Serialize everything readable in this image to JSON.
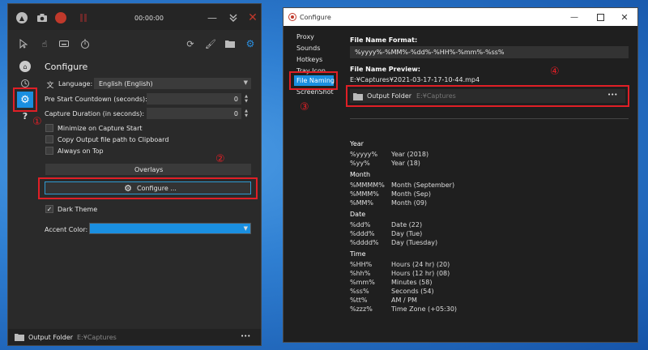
{
  "main": {
    "timer": "00:00:00",
    "title": "Configure",
    "language_label": "Language:",
    "language_value": "English (English)",
    "pre_start_label": "Pre Start Countdown (seconds):",
    "pre_start_value": "0",
    "duration_label": "Capture Duration (in seconds):",
    "duration_value": "0",
    "minimize_label": "Minimize on Capture Start",
    "copy_label": "Copy Output file path to Clipboard",
    "ontop_label": "Always on Top",
    "overlays_label": "Overlays",
    "configure_button": "Configure ...",
    "dark_theme_label": "Dark Theme",
    "dark_theme_checked": true,
    "accent_label": "Accent Color:",
    "accent_color": "#1a8fe0",
    "output_label": "Output Folder",
    "output_path": "E:¥Captures",
    "more": "•••",
    "markers": {
      "one": "①",
      "two": "②"
    }
  },
  "config": {
    "title": "Configure",
    "nav": [
      "Proxy",
      "Sounds",
      "Hotkeys",
      "Tray Icon",
      "File Naming",
      "ScreenShot"
    ],
    "active_nav": "File Naming",
    "format_label": "File Name Format:",
    "format_value": "%yyyy%-%MM%-%dd%-%HH%-%mm%-%ss%",
    "preview_label": "File Name Preview:",
    "preview_value": "E:¥Captures¥2021-03-17-17-10-44.mp4",
    "output_label": "Output Folder",
    "output_path": "E:¥Captures",
    "more": "•••",
    "markers": {
      "three": "③",
      "four": "④"
    },
    "sections": {
      "year": "Year",
      "month": "Month",
      "date": "Date",
      "time": "Time"
    },
    "year_rows": [
      [
        "%yyyy%",
        "Year (2018)"
      ],
      [
        "%yy%",
        "Year (18)"
      ]
    ],
    "month_rows": [
      [
        "%MMMM%",
        "Month (September)"
      ],
      [
        "%MMM%",
        "Month (Sep)"
      ],
      [
        "%MM%",
        "Month (09)"
      ]
    ],
    "date_rows": [
      [
        "%dd%",
        "Date (22)"
      ],
      [
        "%ddd%",
        "Day (Tue)"
      ],
      [
        "%dddd%",
        "Day (Tuesday)"
      ]
    ],
    "time_rows": [
      [
        "%HH%",
        "Hours (24 hr) (20)"
      ],
      [
        "%hh%",
        "Hours (12 hr) (08)"
      ],
      [
        "%mm%",
        "Minutes (58)"
      ],
      [
        "%ss%",
        "Seconds (54)"
      ],
      [
        "%tt%",
        "AM / PM"
      ],
      [
        "%zzz%",
        "Time Zone (+05:30)"
      ]
    ]
  },
  "colors": {
    "red_highlight": "#e01f26",
    "accent": "#1a8fe0"
  }
}
